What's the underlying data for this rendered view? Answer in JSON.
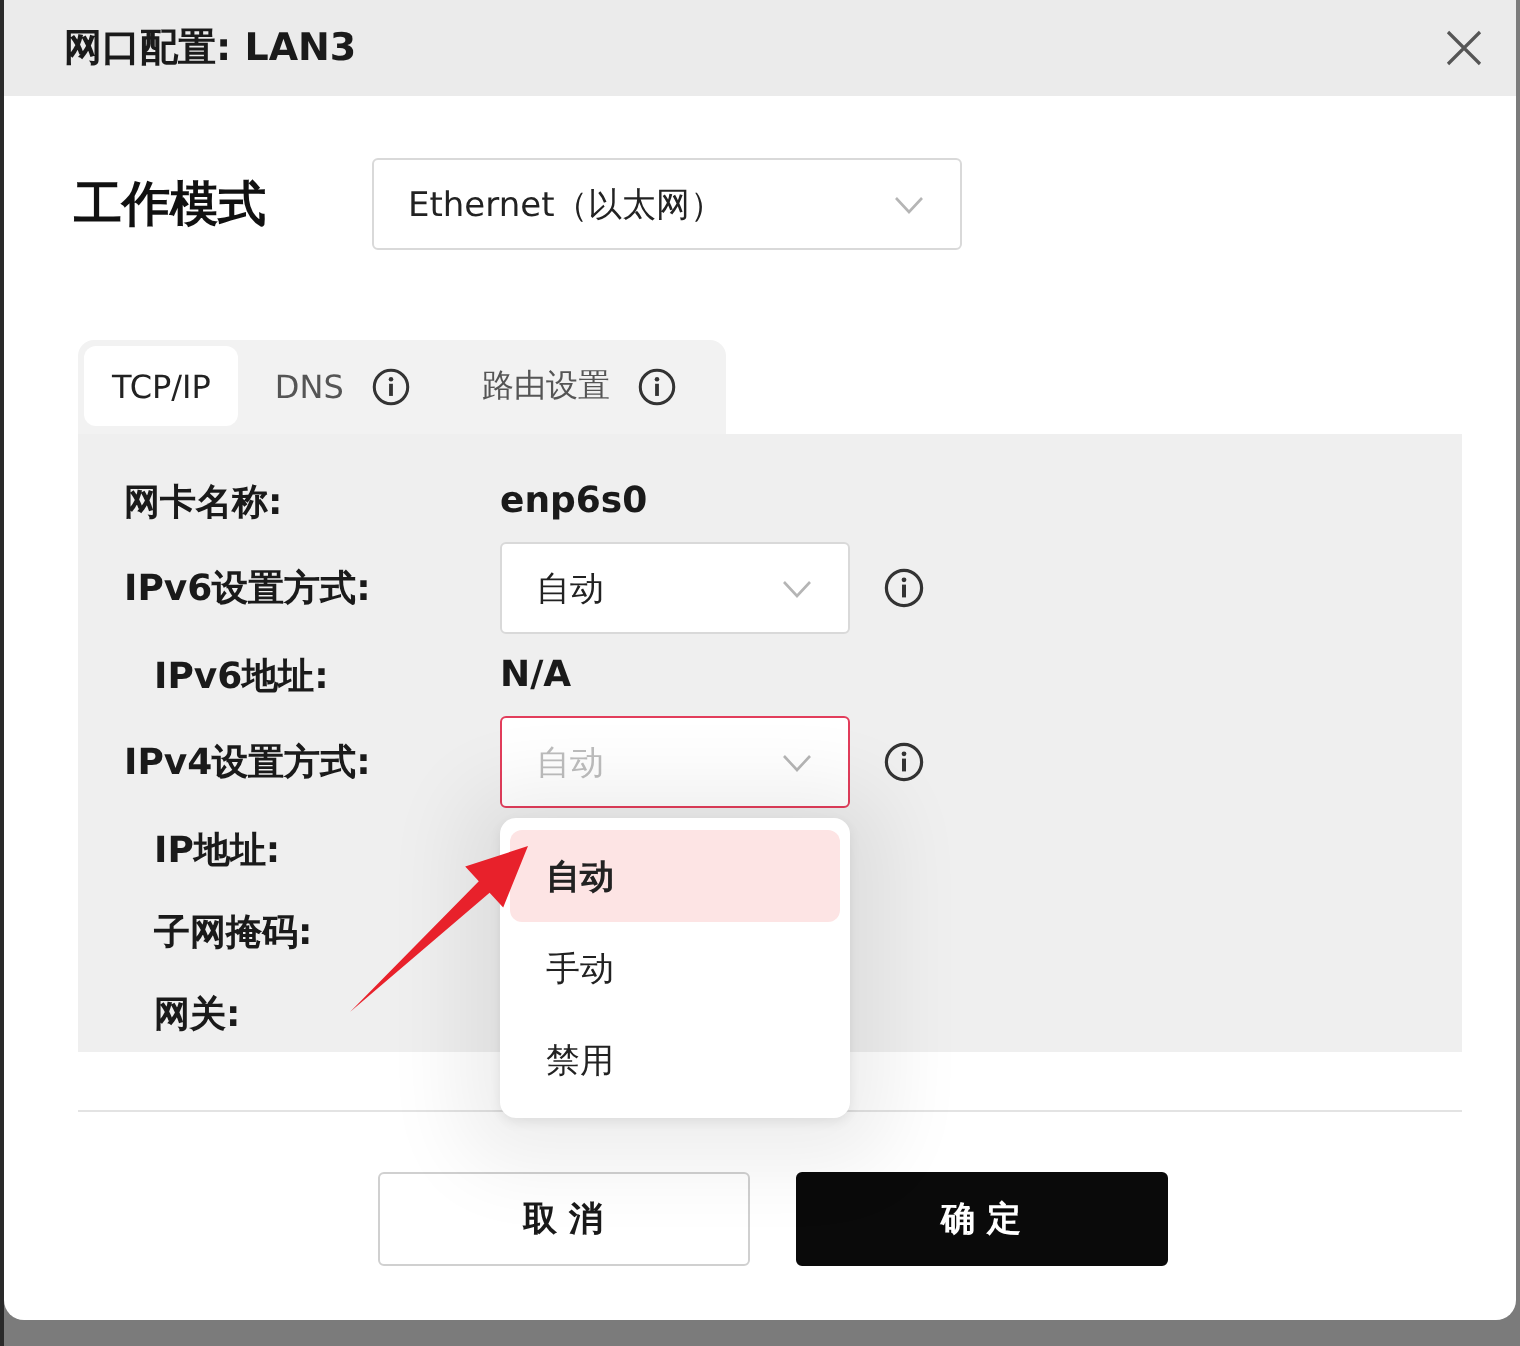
{
  "dialog": {
    "title": "网口配置: LAN3"
  },
  "work_mode": {
    "label": "工作模式",
    "value": "Ethernet（以太网）"
  },
  "tabs": [
    {
      "label": "TCP/IP",
      "selected": true,
      "info": false
    },
    {
      "label": "DNS",
      "selected": false,
      "info": true
    },
    {
      "label": "路由设置",
      "selected": false,
      "info": true
    }
  ],
  "fields": [
    {
      "kind": "text",
      "label": "网卡名称:",
      "value": "enp6s0"
    },
    {
      "kind": "select",
      "label": "IPv6设置方式:",
      "value": "自动",
      "open": false,
      "info": true,
      "children": [
        {
          "kind": "text",
          "label": "IPv6地址:",
          "value": "N/A"
        }
      ]
    },
    {
      "kind": "select",
      "label": "IPv4设置方式:",
      "value": "自动",
      "open": true,
      "info": true,
      "options": [
        {
          "label": "自动",
          "selected": true
        },
        {
          "label": "手动",
          "selected": false
        },
        {
          "label": "禁用",
          "selected": false
        }
      ],
      "children": [
        {
          "kind": "text",
          "label": "IP地址:"
        },
        {
          "kind": "text",
          "label": "子网掩码:"
        },
        {
          "kind": "text",
          "label": "网关:"
        }
      ]
    }
  ],
  "buttons": [
    {
      "label": "取 消",
      "kind": "secondary"
    },
    {
      "label": "确 定",
      "kind": "primary"
    }
  ]
}
